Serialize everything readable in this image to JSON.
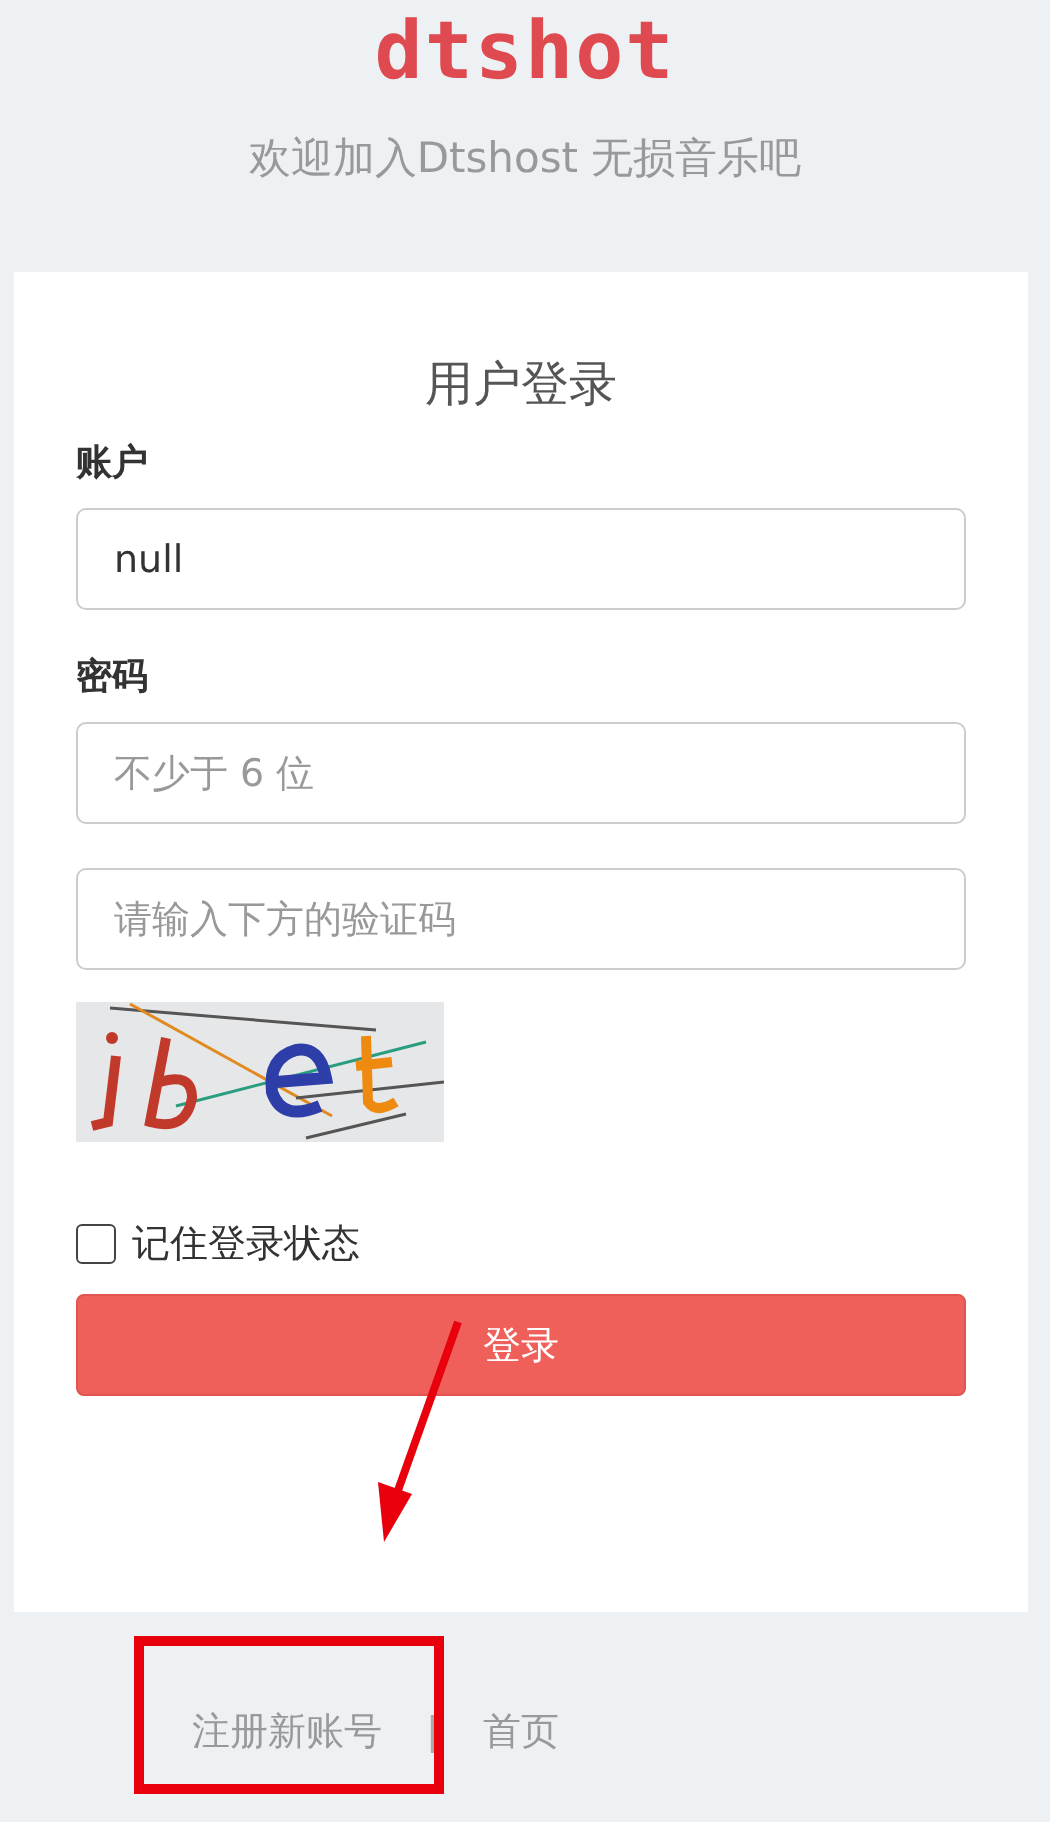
{
  "logo": "dtshot",
  "subtitle": "欢迎加入Dtshost 无损音乐吧",
  "login_card": {
    "title": "用户登录",
    "fields": [
      {
        "kind": "text",
        "label": "账户",
        "value": "null"
      },
      {
        "kind": "password",
        "label": "密码",
        "placeholder": "不少于 6 位"
      },
      {
        "kind": "captcha",
        "placeholder": "请输入下方的验证码"
      }
    ],
    "remember": {
      "label": "记住登录状态",
      "checked": false
    },
    "submit": "登录"
  },
  "footer": {
    "links": [
      "注册新账号",
      "首页"
    ],
    "separator": "|"
  },
  "annotation": {
    "arrow": true,
    "highlight_box": true
  }
}
